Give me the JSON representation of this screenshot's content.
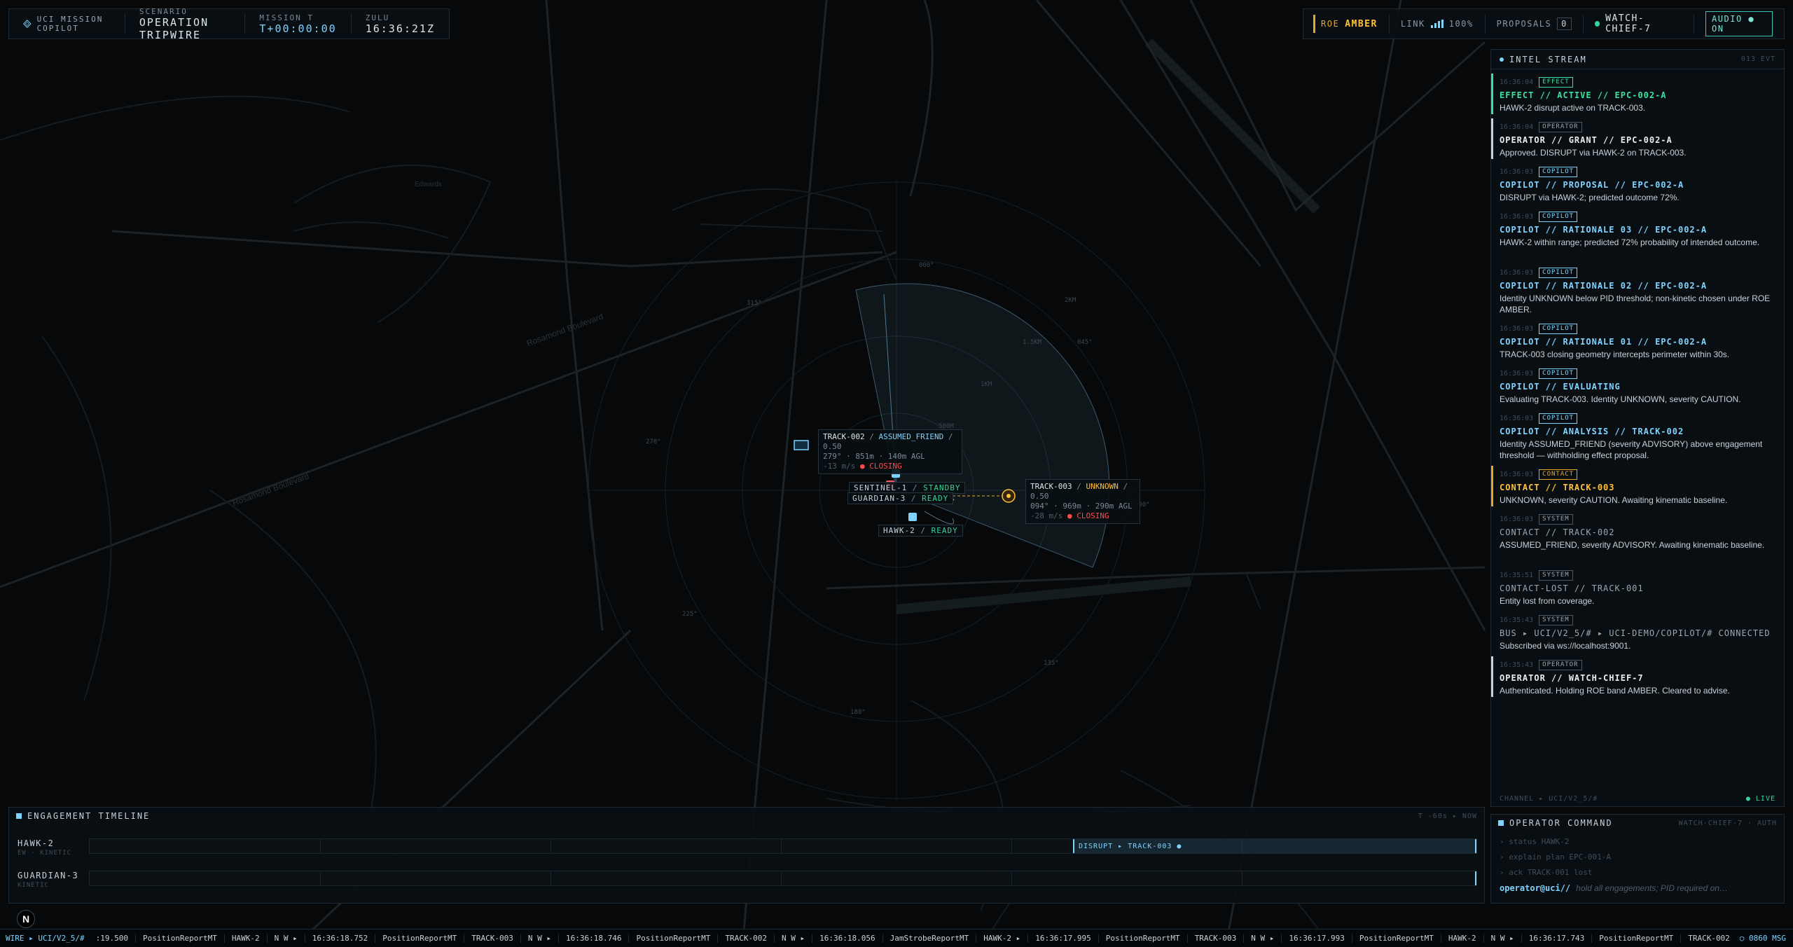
{
  "header": {
    "app_name": "UCI MISSION COPILOT",
    "scenario_label": "SCENARIO",
    "scenario_value": "OPERATION TRIPWIRE",
    "mission_label": "MISSION T",
    "mission_value": "T+00:00:00",
    "zulu_label": "ZULU",
    "zulu_value": "16:36:21Z",
    "roe_label": "ROE",
    "roe_value": "AMBER",
    "link_label": "LINK",
    "link_value": "100%",
    "proposals_label": "PROPOSALS",
    "proposals_count": "0",
    "operator": "WATCH-CHIEF-7",
    "audio_label": "AUDIO ● ON"
  },
  "map": {
    "range_labels": [
      "2KM",
      "1.5KM",
      "1KM",
      "500M"
    ],
    "bearing_labels": [
      "000°",
      "045°",
      "315°",
      "270°",
      "225°",
      "180°",
      "135°",
      "090°"
    ],
    "street_labels": [
      "Rosamond Boulevard",
      "Rosamond Boulevard",
      "Edwards"
    ],
    "track_002": {
      "id": "TRACK-002",
      "affil": "ASSUMED_FRIEND",
      "score": "0.50",
      "line2": "279° · 851m · 140m AGL",
      "speed": "-13 m/s",
      "status": "CLOSING"
    },
    "track_003": {
      "id": "TRACK-003",
      "affil": "UNKNOWN",
      "score": "0.50",
      "line2": "094° · 969m · 290m AGL",
      "speed": "-28 m/s",
      "status": "CLOSING"
    },
    "assets": {
      "sentinel": {
        "name": "SENTINEL-1",
        "status": "STANDBY"
      },
      "guardian": {
        "name": "GUARDIAN-3",
        "status": "READY"
      },
      "hawk": {
        "name": "HAWK-2",
        "status": "READY"
      }
    }
  },
  "intel": {
    "title": "INTEL STREAM",
    "count": "013 EVT",
    "entries": [
      {
        "time": "16:36:04",
        "tag": "EFFECT",
        "title": "EFFECT // ACTIVE // EPC-002-A",
        "body": "HAWK-2 disrupt active on TRACK-003."
      },
      {
        "time": "16:36:04",
        "tag": "OPERATOR",
        "title": "OPERATOR // GRANT // EPC-002-A",
        "body": "Approved. DISRUPT via HAWK-2 on TRACK-003."
      },
      {
        "time": "16:36:03",
        "tag": "COPILOT",
        "title": "COPILOT // PROPOSAL // EPC-002-A",
        "body": "DISRUPT via HAWK-2; predicted outcome 72%."
      },
      {
        "time": "16:36:03",
        "tag": "COPILOT",
        "title": "COPILOT // RATIONALE 03 // EPC-002-A",
        "body": "HAWK-2 within range; predicted 72% probability of intended outcome."
      },
      {
        "time": "16:36:03",
        "tag": "COPILOT",
        "title": "COPILOT // RATIONALE 02 // EPC-002-A",
        "body": "Identity UNKNOWN below PID threshold; non-kinetic chosen under ROE AMBER."
      },
      {
        "time": "16:36:03",
        "tag": "COPILOT",
        "title": "COPILOT // RATIONALE 01 // EPC-002-A",
        "body": "TRACK-003 closing geometry intercepts perimeter within 30s."
      },
      {
        "time": "16:36:03",
        "tag": "COPILOT",
        "title": "COPILOT // EVALUATING",
        "body": "Evaluating TRACK-003. Identity UNKNOWN, severity CAUTION."
      },
      {
        "time": "16:36:03",
        "tag": "COPILOT",
        "title": "COPILOT // ANALYSIS // TRACK-002",
        "body": "Identity ASSUMED_FRIEND (severity ADVISORY) above engagement threshold — withholding effect proposal."
      },
      {
        "time": "16:36:03",
        "tag": "CONTACT",
        "title": "CONTACT // TRACK-003",
        "body": "UNKNOWN, severity CAUTION. Awaiting kinematic baseline."
      },
      {
        "time": "16:36:03",
        "tag": "SYSTEM",
        "title": "CONTACT // TRACK-002",
        "body": "ASSUMED_FRIEND, severity ADVISORY. Awaiting kinematic baseline."
      },
      {
        "time": "16:35:51",
        "tag": "SYSTEM",
        "title": "CONTACT-LOST // TRACK-001",
        "body": "Entity lost from coverage."
      },
      {
        "time": "16:35:43",
        "tag": "SYSTEM",
        "title": "BUS ▸ UCI/V2_5/# ▸ UCI-DEMO/COPILOT/# CONNECTED",
        "body": "Subscribed via ws://localhost:9001."
      },
      {
        "time": "16:35:43",
        "tag": "OPERATOR",
        "title": "OPERATOR // WATCH-CHIEF-7",
        "body": "Authenticated. Holding ROE band AMBER. Cleared to advise."
      }
    ],
    "footer_channel": "CHANNEL ▸ UCI/V2_5/#",
    "footer_live": "● LIVE"
  },
  "operator_command": {
    "title": "OPERATOR COMMAND",
    "auth": "WATCH-CHIEF-7 · AUTH",
    "history": [
      "› status HAWK-2",
      "› explain plan EPC-001-A",
      "› ack TRACK-001 lost"
    ],
    "prompt": "operator@uci//",
    "placeholder": "hold all engagements; PID required on…"
  },
  "timeline": {
    "title": "ENGAGEMENT TIMELINE",
    "range": "T -60s ▸ NOW",
    "rows": [
      {
        "name": "HAWK-2",
        "sub": "EW · KINETIC",
        "segment": "DISRUPT ▸ TRACK-003 ●"
      },
      {
        "name": "GUARDIAN-3",
        "sub": "KINETIC",
        "segment": ""
      }
    ]
  },
  "ticker": {
    "wire": "WIRE ▸ UCI/V2_5/#",
    "messages": [
      ":19.500",
      "PositionReportMT",
      "HAWK-2",
      "N W ▸",
      "16:36:18.752",
      "PositionReportMT",
      "TRACK-003",
      "N W ▸",
      "16:36:18.746",
      "PositionReportMT",
      "TRACK-002",
      "N W ▸",
      "16:36:18.056",
      "JamStrobeReportMT",
      "HAWK-2 ▸",
      "16:36:17.995",
      "PositionReportMT",
      "TRACK-003",
      "N W ▸",
      "16:36:17.993",
      "PositionReportMT",
      "HAWK-2",
      "N W ▸",
      "16:36:17.743",
      "PositionReportMT",
      "TRACK-002",
      "N W ▸"
    ],
    "count": "○ 0860 MSG"
  },
  "colors": {
    "accent": "#7fd3ff",
    "amber": "#ffc23a",
    "hostile": "#ff4a4a",
    "ok": "#35d49a"
  }
}
